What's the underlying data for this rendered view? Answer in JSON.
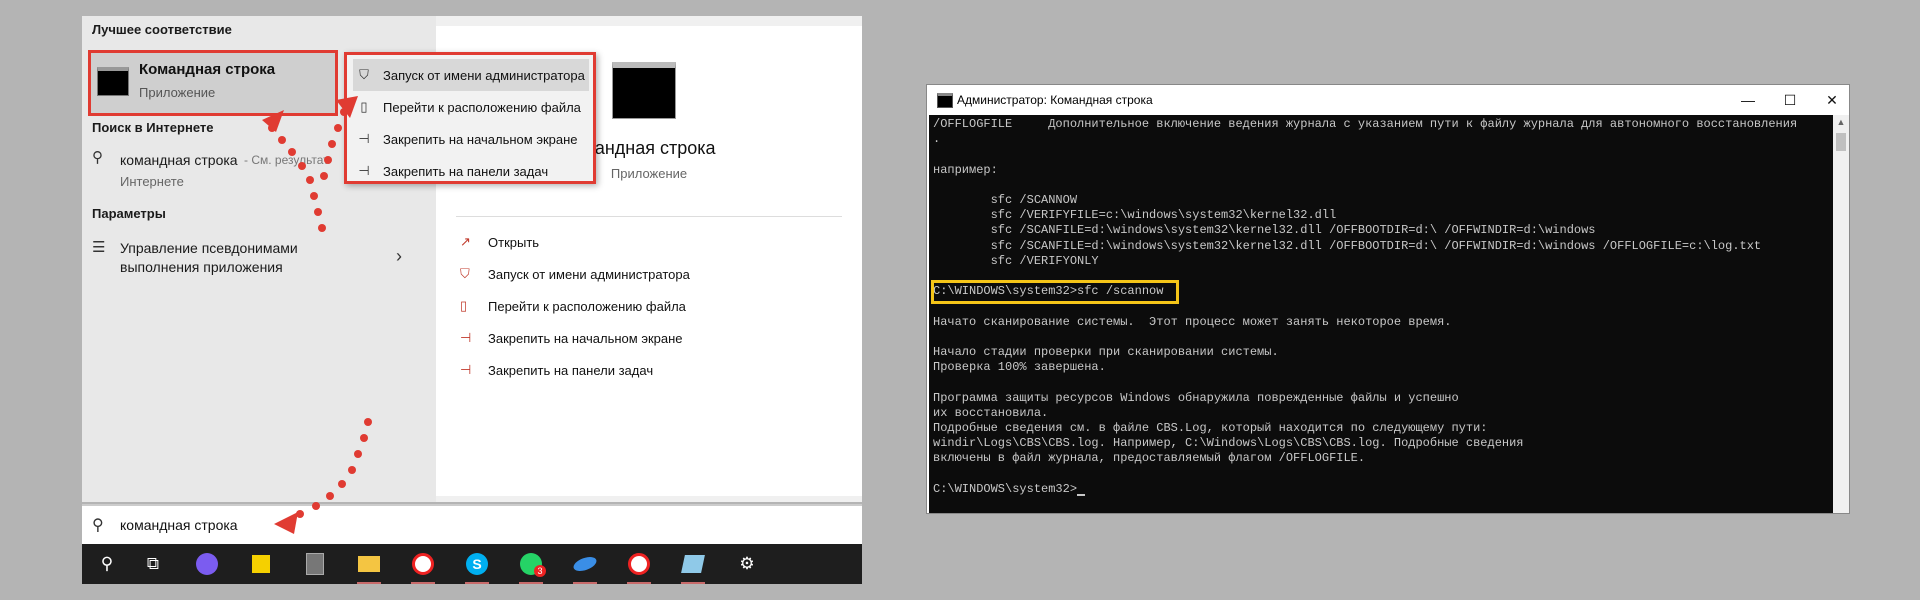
{
  "start_menu": {
    "best_match_header": "Лучшее соответствие",
    "best_match": {
      "title": "Командная строка",
      "subtitle": "Приложение"
    },
    "web_header": "Поиск в Интернете",
    "web_result": {
      "text": "командная строка",
      "suffix": " - См. результат",
      "sub": "Интернете"
    },
    "settings_header": "Параметры",
    "settings_item": {
      "line1": "Управление псевдонимами",
      "line2": "выполнения приложения"
    },
    "context_menu": [
      {
        "label": "Запуск от имени администратора",
        "icon": "shield-icon"
      },
      {
        "label": "Перейти к расположению файла",
        "icon": "folder-icon"
      },
      {
        "label": "Закрепить на начальном экране",
        "icon": "pin-icon"
      },
      {
        "label": "Закрепить на панели задач",
        "icon": "pin-icon"
      }
    ],
    "preview": {
      "title": "Командная строка",
      "title_visible": "мандная строка",
      "subtitle": "Приложение",
      "actions": [
        {
          "label": "Открыть",
          "icon": "open-icon"
        },
        {
          "label": "Запуск от имени администратора",
          "icon": "shield-icon"
        },
        {
          "label": "Перейти к расположению файла",
          "icon": "file-icon"
        },
        {
          "label": "Закрепить на начальном экране",
          "icon": "pin-icon"
        },
        {
          "label": "Закрепить на панели задач",
          "icon": "pin-icon"
        }
      ]
    },
    "search_value": "командная строка"
  },
  "taskbar": {
    "items": [
      {
        "name": "search-icon"
      },
      {
        "name": "task-view-icon"
      },
      {
        "name": "alice-icon"
      },
      {
        "name": "sticky-notes-icon"
      },
      {
        "name": "calculator-icon"
      },
      {
        "name": "file-explorer-icon"
      },
      {
        "name": "yandex-browser-icon"
      },
      {
        "name": "skype-icon"
      },
      {
        "name": "whatsapp-icon",
        "badge": "3"
      },
      {
        "name": "app-icon"
      },
      {
        "name": "yandex-browser-icon-2"
      },
      {
        "name": "app-icon-2"
      },
      {
        "name": "settings-gear-icon"
      }
    ]
  },
  "cmd": {
    "title": "Администратор: Командная строка",
    "lines": [
      "/OFFLOGFILE     Дополнительное включение ведения журнала с указанием пути к файлу журнала для автономного восстановления",
      ".",
      "",
      "например:",
      "",
      "        sfc /SCANNOW",
      "        sfc /VERIFYFILE=c:\\windows\\system32\\kernel32.dll",
      "        sfc /SCANFILE=d:\\windows\\system32\\kernel32.dll /OFFBOOTDIR=d:\\ /OFFWINDIR=d:\\windows",
      "        sfc /SCANFILE=d:\\windows\\system32\\kernel32.dll /OFFBOOTDIR=d:\\ /OFFWINDIR=d:\\windows /OFFLOGFILE=c:\\log.txt",
      "        sfc /VERIFYONLY",
      "",
      "C:\\WINDOWS\\system32>sfc /scannow",
      "",
      "Начато сканирование системы.  Этот процесс может занять некоторое время.",
      "",
      "Начало стадии проверки при сканировании системы.",
      "Проверка 100% завершена.",
      "",
      "Программа защиты ресурсов Windows обнаружила поврежденные файлы и успешно",
      "их восстановила.",
      "Подробные сведения см. в файле CBS.Log, который находится по следующему пути:",
      "windir\\Logs\\CBS\\CBS.log. Например, C:\\Windows\\Logs\\CBS\\CBS.log. Подробные сведения",
      "включены в файл журнала, предоставляемый флагом /OFFLOGFILE.",
      "",
      "C:\\WINDOWS\\system32>"
    ]
  },
  "colors": {
    "highlight_red": "#e03b32",
    "highlight_yellow": "#f5c518"
  }
}
